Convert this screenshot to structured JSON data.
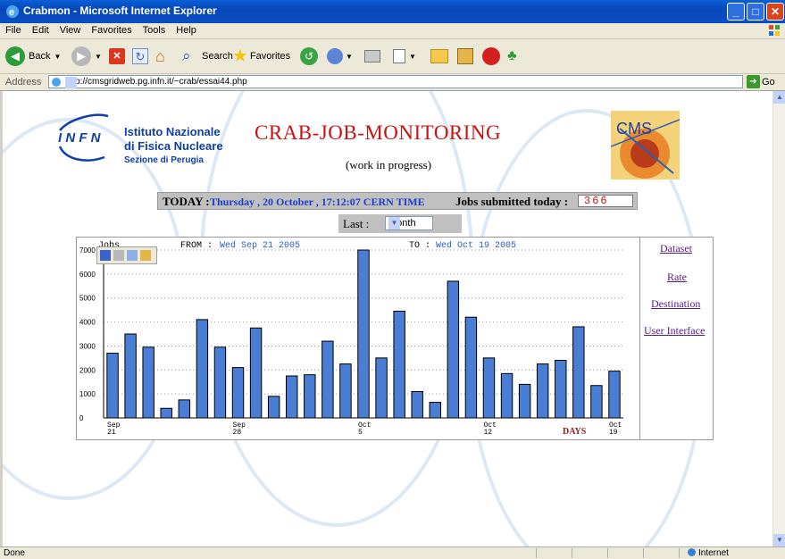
{
  "window": {
    "title": "Crabmon - Microsoft Internet Explorer",
    "buttons": {
      "minimize": "_",
      "maximize": "□",
      "close": "✕"
    }
  },
  "menu": [
    "File",
    "Edit",
    "View",
    "Favorites",
    "Tools",
    "Help"
  ],
  "toolbar": {
    "back_label": "Back",
    "search_label": "Search",
    "favorites_label": "Favorites"
  },
  "address": {
    "label": "Address",
    "url": "http://cmsgridweb.pg.infn.it/~crab/essai44.php",
    "go_label": "Go"
  },
  "page": {
    "infn": {
      "letters": "I N F N",
      "line1": "Istituto Nazionale",
      "line2": "di Fisica Nucleare",
      "line3": "Sezione di Perugia"
    },
    "title": "CRAB-JOB-MONITORING",
    "subtitle": "(work in progress)",
    "today_label": "TODAY :",
    "today_value": "Thursday , 20 October , 17:12:07 CERN TIME",
    "jobs_label": "Jobs submitted today :",
    "jobs_value": "366",
    "last_label": "Last :",
    "last_selected": "Month",
    "links": [
      "Dataset",
      "Rate",
      "Destination",
      "User Interface"
    ]
  },
  "chart_data": {
    "type": "bar",
    "ylabel": "Jobs",
    "from_label": "FROM :",
    "from_value": "Wed Sep 21 2005",
    "to_label": "TO :",
    "to_value": "Wed Oct 19 2005",
    "xlabel": "DAYS",
    "ylim": [
      0,
      7000
    ],
    "yticks": [
      0,
      1000,
      2000,
      3000,
      4000,
      5000,
      6000,
      7000
    ],
    "grid": true,
    "bar_color": "#4a7ed4",
    "x_tick_labels": [
      {
        "index": 0,
        "month": "Sep",
        "day": "21"
      },
      {
        "index": 7,
        "month": "Sep",
        "day": "28"
      },
      {
        "index": 14,
        "month": "Oct",
        "day": "5"
      },
      {
        "index": 21,
        "month": "Oct",
        "day": "12"
      },
      {
        "index": 28,
        "month": "Oct",
        "day": "19"
      }
    ],
    "values": [
      2700,
      3500,
      2950,
      400,
      750,
      4100,
      2950,
      2100,
      3750,
      900,
      1750,
      1800,
      3200,
      2250,
      7000,
      2500,
      4450,
      1100,
      650,
      5700,
      4200,
      2500,
      1850,
      1400,
      2250,
      2400,
      3800,
      1350,
      1950
    ]
  },
  "status": {
    "left": "Done",
    "zone": "Internet"
  }
}
